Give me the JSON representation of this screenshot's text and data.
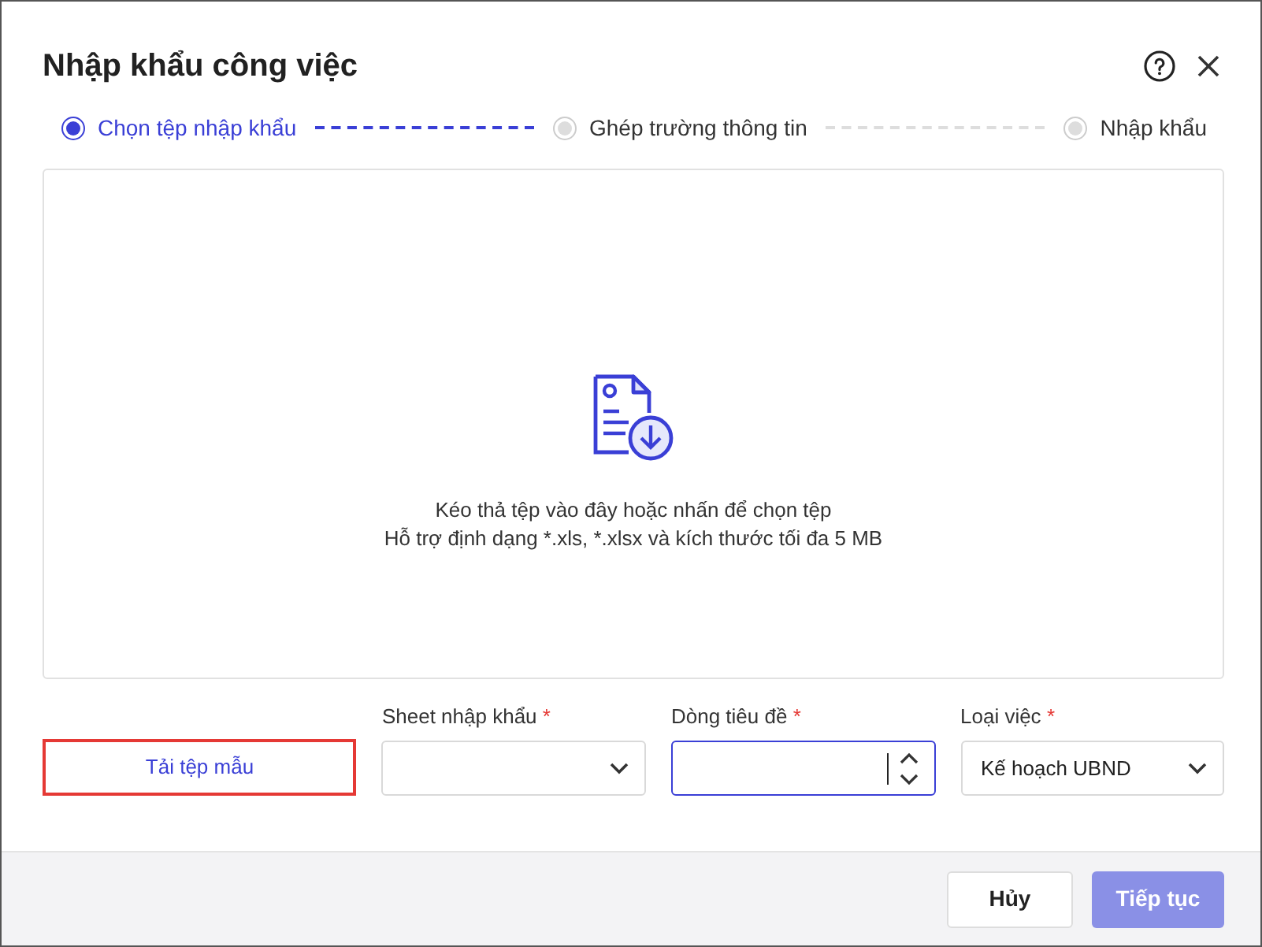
{
  "dialog": {
    "title": "Nhập khẩu công việc"
  },
  "steps": [
    {
      "label": "Chọn tệp nhập khẩu",
      "selected": true
    },
    {
      "label": "Ghép trường thông tin",
      "selected": false
    },
    {
      "label": "Nhập khẩu",
      "selected": false
    }
  ],
  "dropzone": {
    "lines": [
      "Kéo thả tệp vào đây hoặc nhấn để chọn tệp",
      "Hỗ trợ định dạng *.xls, *.xlsx và kích thước tối đa 5 MB"
    ]
  },
  "template_button": {
    "label": "Tải tệp mẫu"
  },
  "fields": [
    {
      "kind": "select",
      "label": "Sheet nhập khẩu",
      "required_mark": "*",
      "focused": false
    },
    {
      "kind": "number",
      "label": "Dòng tiêu đề",
      "required_mark": "*",
      "focused": true
    },
    {
      "kind": "select",
      "label": "Loại việc",
      "required_mark": "*",
      "value": "Kế hoạch UBND",
      "focused": false
    }
  ],
  "footer": {
    "buttons": [
      {
        "label": "Hủy",
        "kind": "secondary",
        "disabled": false
      },
      {
        "label": "Tiếp tục",
        "kind": "primary",
        "disabled": true
      }
    ]
  }
}
